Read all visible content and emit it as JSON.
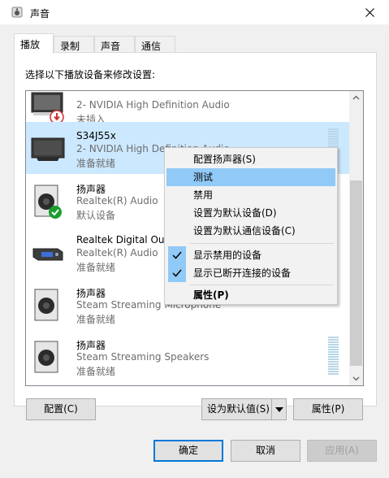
{
  "window": {
    "title": "声音",
    "close_icon": "close-icon",
    "app_icon": "speaker-app-icon"
  },
  "tabs": [
    {
      "label": "播放",
      "active": true
    },
    {
      "label": "录制",
      "active": false
    },
    {
      "label": "声音",
      "active": false
    },
    {
      "label": "通信",
      "active": false
    }
  ],
  "instruction": "选择以下播放设备来修改设置:",
  "devices": [
    {
      "name": "",
      "desc": "2- NVIDIA High Definition Audio",
      "status": "未插入",
      "icon": "monitor-unplugged-icon",
      "selected": false
    },
    {
      "name": "S34J55x",
      "desc": "2- NVIDIA High Definition Audio",
      "status": "准备就绪",
      "icon": "monitor-icon",
      "selected": true
    },
    {
      "name": "扬声器",
      "desc": "Realtek(R) Audio",
      "status": "默认设备",
      "icon": "speaker-default-icon",
      "selected": false
    },
    {
      "name": "Realtek Digital Output",
      "desc": "Realtek(R) Audio",
      "status": "准备就绪",
      "icon": "digital-output-icon",
      "selected": false
    },
    {
      "name": "扬声器",
      "desc": "Steam Streaming Microphone",
      "status": "准备就绪",
      "icon": "speaker-icon",
      "selected": false
    },
    {
      "name": "扬声器",
      "desc": "Steam Streaming Speakers",
      "status": "准备就绪",
      "icon": "speaker-icon",
      "selected": false
    }
  ],
  "context_menu": [
    {
      "label": "配置扬声器(S)",
      "highlighted": false,
      "checked": false,
      "bold": false
    },
    {
      "label": "测试",
      "highlighted": true,
      "checked": false,
      "bold": false
    },
    {
      "label": "禁用",
      "highlighted": false,
      "checked": false,
      "bold": false
    },
    {
      "label": "设置为默认设备(D)",
      "highlighted": false,
      "checked": false,
      "bold": false
    },
    {
      "label": "设置为默认通信设备(C)",
      "highlighted": false,
      "checked": false,
      "bold": false
    },
    {
      "label": "显示禁用的设备",
      "highlighted": false,
      "checked": true,
      "bold": false
    },
    {
      "label": "显示已断开连接的设备",
      "highlighted": false,
      "checked": true,
      "bold": false
    },
    {
      "label": "属性(P)",
      "highlighted": false,
      "checked": false,
      "bold": true
    }
  ],
  "buttons": {
    "configure": "配置(C)",
    "set_default": "设为默认值(S)",
    "properties": "属性(P)",
    "ok": "确定",
    "cancel": "取消",
    "apply": "应用(A)"
  },
  "colors": {
    "accent": "#0078d7",
    "selection": "#cce8ff",
    "menu_highlight": "#91c9f7"
  }
}
